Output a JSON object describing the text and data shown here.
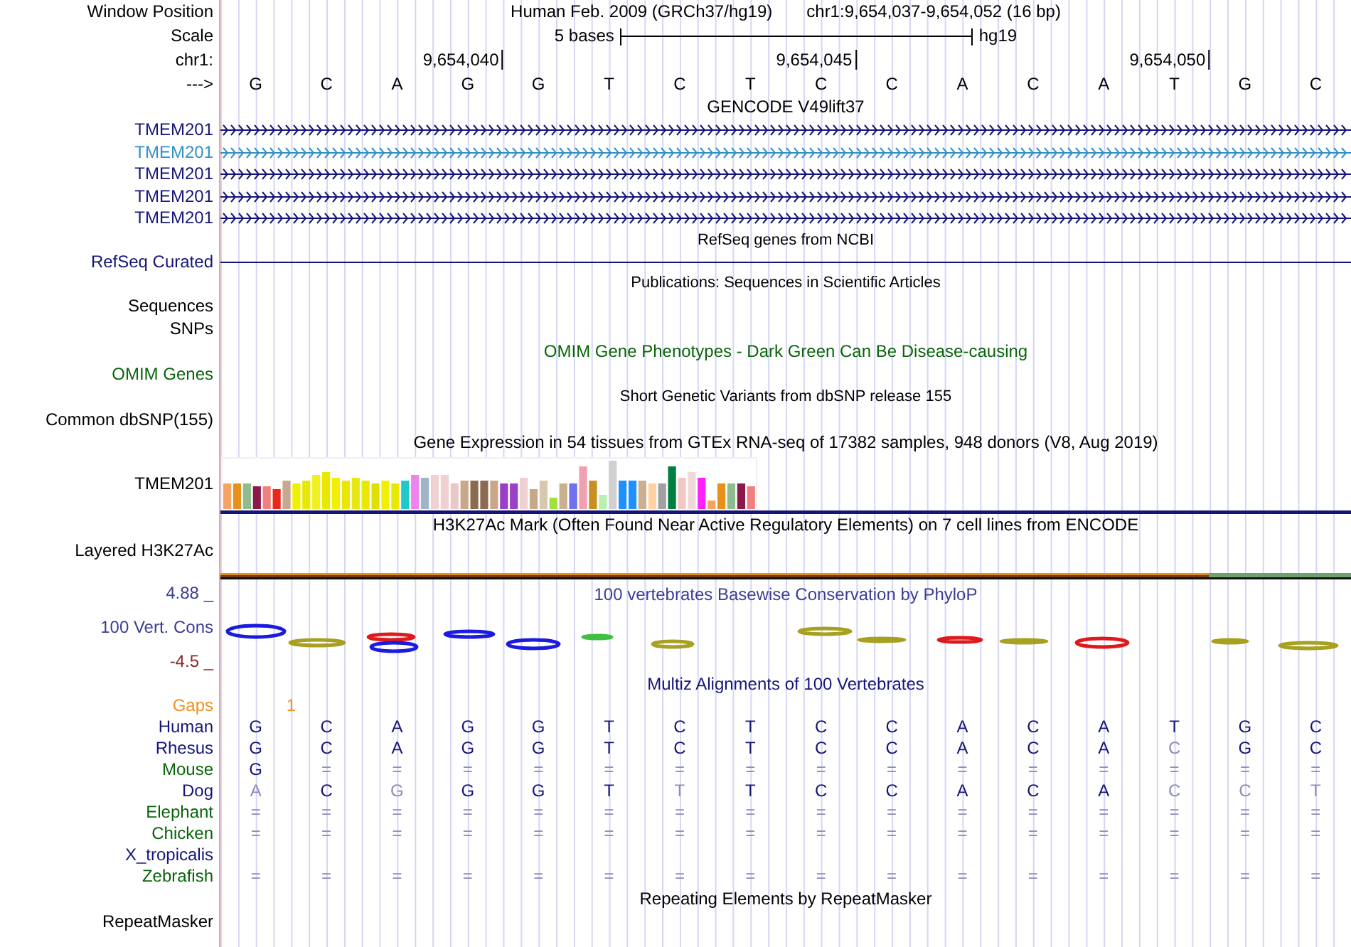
{
  "header": {
    "position_label": "Window Position",
    "assembly": "Human Feb. 2009 (GRCh37/hg19)",
    "range": "chr1:9,654,037-9,654,052 (16 bp)",
    "scale_label": "Scale",
    "scale_text": "5 bases",
    "scale_db": "hg19",
    "chrom_label": "chr1:",
    "ticks": [
      "9,654,040",
      "9,654,045",
      "9,654,050"
    ],
    "strand_label": "--->",
    "bases": [
      "G",
      "C",
      "A",
      "G",
      "G",
      "T",
      "C",
      "T",
      "C",
      "C",
      "A",
      "C",
      "A",
      "T",
      "G",
      "C"
    ]
  },
  "tracks": [
    {
      "kind": "title",
      "text": "GENCODE V49lift37",
      "color": "#000000"
    },
    {
      "kind": "gene",
      "label": "TMEM201",
      "color": "#151578"
    },
    {
      "kind": "gene",
      "label": "TMEM201",
      "color": "#3290c8"
    },
    {
      "kind": "gene",
      "label": "TMEM201",
      "color": "#151578"
    },
    {
      "kind": "gene",
      "label": "TMEM201",
      "color": "#151578"
    },
    {
      "kind": "gene",
      "label": "TMEM201",
      "color": "#151578"
    },
    {
      "kind": "subtitle",
      "text": "RefSeq genes from NCBI",
      "color": "#000000"
    },
    {
      "kind": "line",
      "label": "RefSeq Curated",
      "color": "#151578"
    },
    {
      "kind": "subtitle",
      "text": "Publications: Sequences in Scientific Articles",
      "color": "#000000"
    },
    {
      "kind": "empty",
      "label": "Sequences",
      "color": "#000000"
    },
    {
      "kind": "empty",
      "label": "SNPs",
      "color": "#000000"
    },
    {
      "kind": "title",
      "text": "OMIM Gene Phenotypes - Dark Green Can Be Disease-causing",
      "color": "#0a640a"
    },
    {
      "kind": "empty",
      "label": "OMIM Genes",
      "color": "#0a640a"
    },
    {
      "kind": "subtitle",
      "text": "Short Genetic Variants from dbSNP release 155",
      "color": "#000000"
    },
    {
      "kind": "empty",
      "label": "Common dbSNP(155)",
      "color": "#000000"
    },
    {
      "kind": "title",
      "text": "Gene Expression in 54 tissues from GTEx RNA-seq of 17382 samples, 948 donors (V8, Aug 2019)",
      "color": "#000000"
    },
    {
      "kind": "bars",
      "label": "TMEM201",
      "color": "#000000"
    },
    {
      "kind": "title",
      "text": "H3K27Ac Mark (Often Found Near Active Regulatory Elements) on 7 cell lines from ENCODE",
      "color": "#000000"
    },
    {
      "kind": "signal",
      "label": "Layered H3K27Ac",
      "color": "#000000"
    },
    {
      "kind": "conservation",
      "label": "100 Vert. Cons",
      "max": "4.88 _",
      "min": "-4.5 _",
      "title": "100 vertebrates Basewise Conservation by PhyloP",
      "color": "#3c3c96"
    },
    {
      "kind": "title",
      "text": "Multiz Alignments of 100 Vertebrates",
      "color": "#151578"
    },
    {
      "kind": "gaps",
      "label": "Gaps",
      "mark": "1",
      "color": "#f0901e"
    },
    {
      "kind": "alignment",
      "label": "Human",
      "color": "#151578",
      "cells": [
        {
          "t": "G",
          "faded": false
        },
        {
          "t": "C",
          "faded": false
        },
        {
          "t": "A",
          "faded": false
        },
        {
          "t": "G",
          "faded": false
        },
        {
          "t": "G",
          "faded": false
        },
        {
          "t": "T",
          "faded": false
        },
        {
          "t": "C",
          "faded": false
        },
        {
          "t": "T",
          "faded": false
        },
        {
          "t": "C",
          "faded": false
        },
        {
          "t": "C",
          "faded": false
        },
        {
          "t": "A",
          "faded": false
        },
        {
          "t": "C",
          "faded": false
        },
        {
          "t": "A",
          "faded": false
        },
        {
          "t": "T",
          "faded": false
        },
        {
          "t": "G",
          "faded": false
        },
        {
          "t": "C",
          "faded": false
        }
      ]
    },
    {
      "kind": "alignment",
      "label": "Rhesus",
      "color": "#151578",
      "cells": [
        {
          "t": "G",
          "faded": false
        },
        {
          "t": "C",
          "faded": false
        },
        {
          "t": "A",
          "faded": false
        },
        {
          "t": "G",
          "faded": false
        },
        {
          "t": "G",
          "faded": false
        },
        {
          "t": "T",
          "faded": false
        },
        {
          "t": "C",
          "faded": false
        },
        {
          "t": "T",
          "faded": false
        },
        {
          "t": "C",
          "faded": false
        },
        {
          "t": "C",
          "faded": false
        },
        {
          "t": "A",
          "faded": false
        },
        {
          "t": "C",
          "faded": false
        },
        {
          "t": "A",
          "faded": false
        },
        {
          "t": "C",
          "faded": true
        },
        {
          "t": "G",
          "faded": false
        },
        {
          "t": "C",
          "faded": false
        }
      ]
    },
    {
      "kind": "alignment",
      "label": "Mouse",
      "color": "#0a640a",
      "cells": [
        {
          "t": "G",
          "faded": false
        },
        {
          "t": "=",
          "faded": true
        },
        {
          "t": "=",
          "faded": true
        },
        {
          "t": "=",
          "faded": true
        },
        {
          "t": "=",
          "faded": true
        },
        {
          "t": "=",
          "faded": true
        },
        {
          "t": "=",
          "faded": true
        },
        {
          "t": "=",
          "faded": true
        },
        {
          "t": "=",
          "faded": true
        },
        {
          "t": "=",
          "faded": true
        },
        {
          "t": "=",
          "faded": true
        },
        {
          "t": "=",
          "faded": true
        },
        {
          "t": "=",
          "faded": true
        },
        {
          "t": "=",
          "faded": true
        },
        {
          "t": "=",
          "faded": true
        },
        {
          "t": "=",
          "faded": true
        }
      ]
    },
    {
      "kind": "alignment",
      "label": "Dog",
      "color": "#151578",
      "cells": [
        {
          "t": "A",
          "faded": true
        },
        {
          "t": "C",
          "faded": false
        },
        {
          "t": "G",
          "faded": true
        },
        {
          "t": "G",
          "faded": false
        },
        {
          "t": "G",
          "faded": false
        },
        {
          "t": "T",
          "faded": false
        },
        {
          "t": "T",
          "faded": true
        },
        {
          "t": "T",
          "faded": false
        },
        {
          "t": "C",
          "faded": false
        },
        {
          "t": "C",
          "faded": false
        },
        {
          "t": "A",
          "faded": false
        },
        {
          "t": "C",
          "faded": false
        },
        {
          "t": "A",
          "faded": false
        },
        {
          "t": "C",
          "faded": true
        },
        {
          "t": "C",
          "faded": true
        },
        {
          "t": "T",
          "faded": true
        }
      ]
    },
    {
      "kind": "alignment",
      "label": "Elephant",
      "color": "#0a640a",
      "cells": [
        {
          "t": "=",
          "faded": true
        },
        {
          "t": "=",
          "faded": true
        },
        {
          "t": "=",
          "faded": true
        },
        {
          "t": "=",
          "faded": true
        },
        {
          "t": "=",
          "faded": true
        },
        {
          "t": "=",
          "faded": true
        },
        {
          "t": "=",
          "faded": true
        },
        {
          "t": "=",
          "faded": true
        },
        {
          "t": "=",
          "faded": true
        },
        {
          "t": "=",
          "faded": true
        },
        {
          "t": "=",
          "faded": true
        },
        {
          "t": "=",
          "faded": true
        },
        {
          "t": "=",
          "faded": true
        },
        {
          "t": "=",
          "faded": true
        },
        {
          "t": "=",
          "faded": true
        },
        {
          "t": "=",
          "faded": true
        }
      ]
    },
    {
      "kind": "alignment",
      "label": "Chicken",
      "color": "#0a640a",
      "cells": [
        {
          "t": "=",
          "faded": true
        },
        {
          "t": "=",
          "faded": true
        },
        {
          "t": "=",
          "faded": true
        },
        {
          "t": "=",
          "faded": true
        },
        {
          "t": "=",
          "faded": true
        },
        {
          "t": "=",
          "faded": true
        },
        {
          "t": "=",
          "faded": true
        },
        {
          "t": "=",
          "faded": true
        },
        {
          "t": "=",
          "faded": true
        },
        {
          "t": "=",
          "faded": true
        },
        {
          "t": "=",
          "faded": true
        },
        {
          "t": "=",
          "faded": true
        },
        {
          "t": "=",
          "faded": true
        },
        {
          "t": "=",
          "faded": true
        },
        {
          "t": "=",
          "faded": true
        },
        {
          "t": "=",
          "faded": true
        }
      ]
    },
    {
      "kind": "alignment",
      "label": "X_tropicalis",
      "color": "#151578"
    },
    {
      "kind": "alignment",
      "label": "Zebrafish",
      "color": "#0a640a",
      "cells": [
        {
          "t": "=",
          "faded": true
        },
        {
          "t": "=",
          "faded": true
        },
        {
          "t": "=",
          "faded": true
        },
        {
          "t": "=",
          "faded": true
        },
        {
          "t": "=",
          "faded": true
        },
        {
          "t": "=",
          "faded": true
        },
        {
          "t": "=",
          "faded": true
        },
        {
          "t": "=",
          "faded": true
        },
        {
          "t": "=",
          "faded": true
        },
        {
          "t": "=",
          "faded": true
        },
        {
          "t": "=",
          "faded": true
        },
        {
          "t": "=",
          "faded": true
        },
        {
          "t": "=",
          "faded": true
        },
        {
          "t": "=",
          "faded": true
        },
        {
          "t": "=",
          "faded": true
        },
        {
          "t": "=",
          "faded": true
        }
      ]
    },
    {
      "kind": "title",
      "text": "Repeating Elements by RepeatMasker",
      "color": "#000000"
    },
    {
      "kind": "empty",
      "label": "RepeatMasker",
      "color": "#000000"
    }
  ]
}
